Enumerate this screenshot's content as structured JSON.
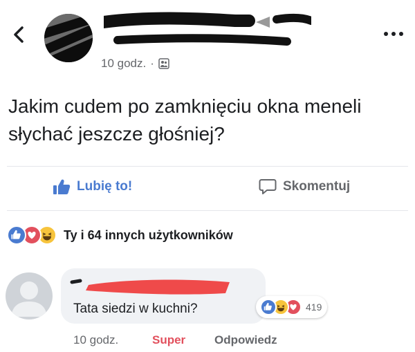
{
  "post": {
    "time": "10 godz.",
    "separator": "·",
    "audience_icon": "friends-icon",
    "text": "Jakim cudem po zamknięciu okna meneli słychać jeszcze głośniej?"
  },
  "actions": {
    "like_label": "Lubię to!",
    "comment_label": "Skomentuj"
  },
  "reactions": {
    "icons": [
      "like-icon",
      "love-icon",
      "haha-icon"
    ],
    "summary": "Ty i 64 innych użytkowników"
  },
  "comment": {
    "text": "Tata siedzi w kuchni?",
    "reactions_icons": [
      "like-icon",
      "haha-icon",
      "love-icon"
    ],
    "reactions_count": "419",
    "time": "10 godz.",
    "reaction_label": "Super",
    "reply_label": "Odpowiedz"
  },
  "colors": {
    "like_blue": "#4a7bd0",
    "love_red": "#e2505d",
    "haha_yellow": "#f7c43c",
    "muted_text": "#65676b"
  }
}
